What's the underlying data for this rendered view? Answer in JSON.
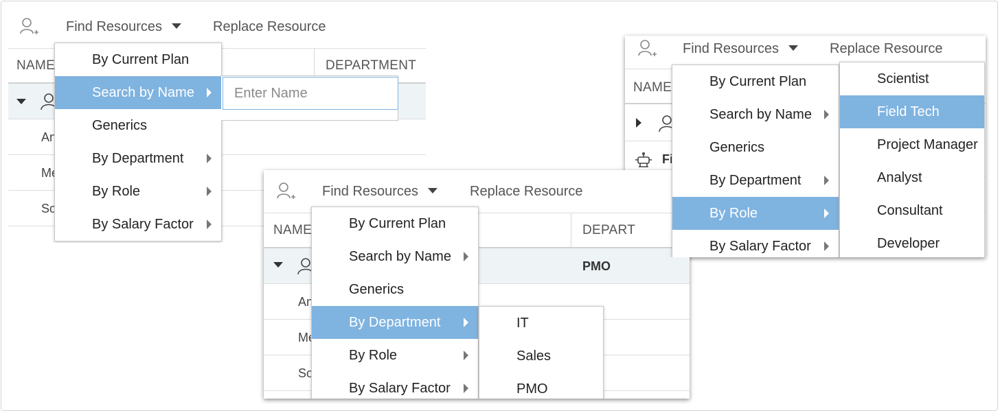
{
  "toolbar": {
    "find_resources_label": "Find Resources",
    "replace_resource_label": "Replace Resource"
  },
  "grid": {
    "col_name": "NAME",
    "col_department": "DEPARTMENT",
    "col_depart_truncated": "DEPART",
    "col_name_truncated": "NAME",
    "row_pmo": "PMO",
    "row_prefix_1": "An",
    "row_prefix_2": "Me",
    "row_prefix_3": "So",
    "row_prefix_fi": "Fi",
    "row_prefix_a": "A"
  },
  "menu": {
    "items": [
      {
        "label": "By Current Plan"
      },
      {
        "label": "Search by Name"
      },
      {
        "label": "Generics"
      },
      {
        "label": "By Department"
      },
      {
        "label": "By Role"
      },
      {
        "label": "By Salary Factor"
      }
    ]
  },
  "search": {
    "placeholder": "Enter Name"
  },
  "departments": [
    "IT",
    "Sales",
    "PMO"
  ],
  "roles": [
    "Scientist",
    "Field Tech",
    "Project Manager",
    "Analyst",
    "Consultant",
    "Developer"
  ],
  "colors": {
    "highlight": "#7fb3e0",
    "selected_row": "#eef3f5"
  },
  "icons": {
    "add_user": "add-user-icon",
    "user": "user-icon",
    "robot": "robot-icon",
    "caret": "caret-down-icon",
    "submenu_arrow": "chevron-right-icon"
  }
}
